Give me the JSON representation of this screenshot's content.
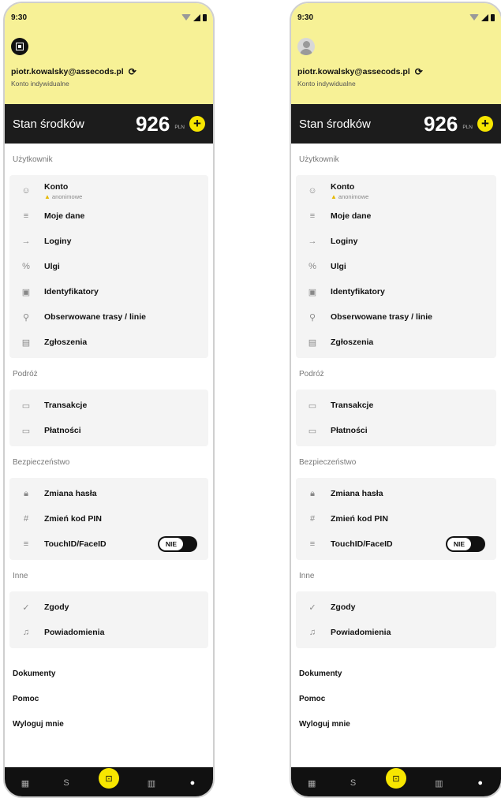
{
  "status_bar": {
    "time": "9:30"
  },
  "account": {
    "email": "piotr.kowalsky@assecods.pl",
    "type": "Konto indywidualne"
  },
  "balance": {
    "label": "Stan środków",
    "amount": "926",
    "currency": "PLN"
  },
  "sections": {
    "user": {
      "title": "Użytkownik",
      "items": [
        {
          "label": "Konto",
          "sub": "anonimowe",
          "icon": "account-circle-icon"
        },
        {
          "label": "Moje dane",
          "icon": "edit-list-icon"
        },
        {
          "label": "Loginy",
          "icon": "login-icon"
        },
        {
          "label": "Ulgi",
          "icon": "percent-icon"
        },
        {
          "label": "Identyfikatory",
          "icon": "id-card-icon"
        },
        {
          "label": "Obserwowane trasy / linie",
          "icon": "route-icon"
        },
        {
          "label": "Zgłoszenia",
          "icon": "message-icon"
        }
      ]
    },
    "travel": {
      "title": "Podróż",
      "items": [
        {
          "label": "Transakcje",
          "icon": "cash-icon"
        },
        {
          "label": "Płatności",
          "icon": "card-icon"
        }
      ]
    },
    "security": {
      "title": "Bezpieczeństwo",
      "items": [
        {
          "label": "Zmiana hasła",
          "icon": "lock-icon"
        },
        {
          "label": "Zmień kod PIN",
          "icon": "pin-icon"
        },
        {
          "label": "TouchID/FaceID",
          "icon": "biometric-icon",
          "toggle": "NIE"
        }
      ]
    },
    "other": {
      "title": "Inne",
      "items": [
        {
          "label": "Zgody",
          "icon": "check-circle-icon"
        },
        {
          "label": "Powiadomienia",
          "icon": "bell-icon"
        }
      ]
    }
  },
  "links": [
    "Dokumenty",
    "Pomoc",
    "Wyloguj mnie"
  ],
  "colors": {
    "header": "#f7f196",
    "accent": "#f7e600",
    "dark": "#1c1c1c"
  }
}
